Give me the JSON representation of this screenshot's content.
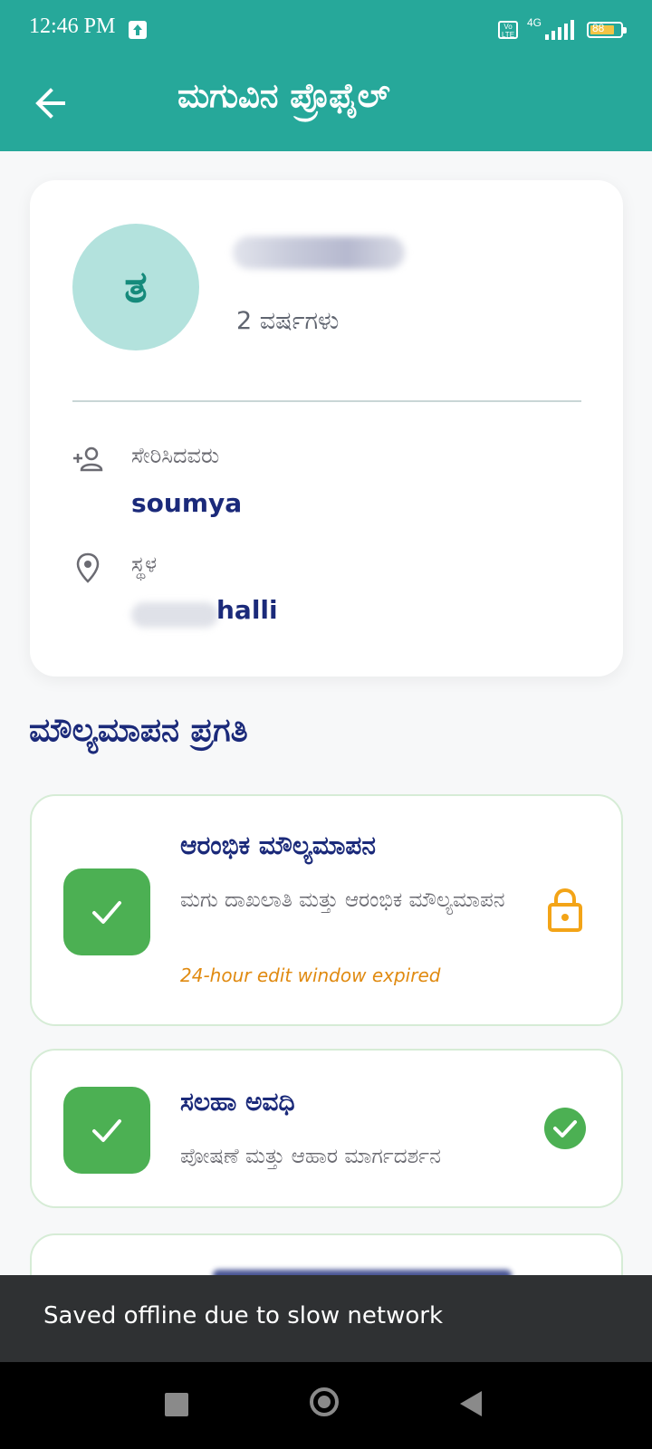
{
  "status_bar": {
    "time": "12:46 PM",
    "network": "4G",
    "volte": "Vo LTE",
    "battery": "88"
  },
  "app_bar": {
    "title": "ಮಗುವಿನ ಪ್ರೊಫೈಲ್",
    "back_icon": "arrow-left-icon"
  },
  "profile": {
    "avatar_initial": "ತ",
    "name": "",
    "age": "2 ವರ್ಷಗಳು",
    "added_by_label": "ಸೇರಿಸಿದವರು",
    "added_by_value": "soumya",
    "location_label": "ಸ್ಥಳ",
    "location_value": "halli"
  },
  "section": {
    "title": "ಮೌಲ್ಯಮಾಪನ ಪ್ರಗತಿ"
  },
  "steps": [
    {
      "title": "ಆರಂಭಿಕ ಮೌಲ್ಯಮಾಪನ",
      "description": "ಮಗು ದಾಖಲಾತಿ ಮತ್ತು ಆರಂಭಿಕ ಮೌಲ್ಯಮಾಪನ",
      "note": "24-hour edit window expired",
      "status_icon": "lock-icon"
    },
    {
      "title": "ಸಲಹಾ ಅವಧಿ",
      "description": "ಪೋಷಣೆ ಮತ್ತು ಆಹಾರ ಮಾರ್ಗದರ್ಶನ",
      "status_icon": "check-circle-icon"
    }
  ],
  "snackbar": {
    "message": "Saved offline due to slow network"
  },
  "colors": {
    "primary": "#26a89a",
    "navy": "#1b2a7a",
    "success": "#4cb053",
    "warning": "#f3a417"
  }
}
